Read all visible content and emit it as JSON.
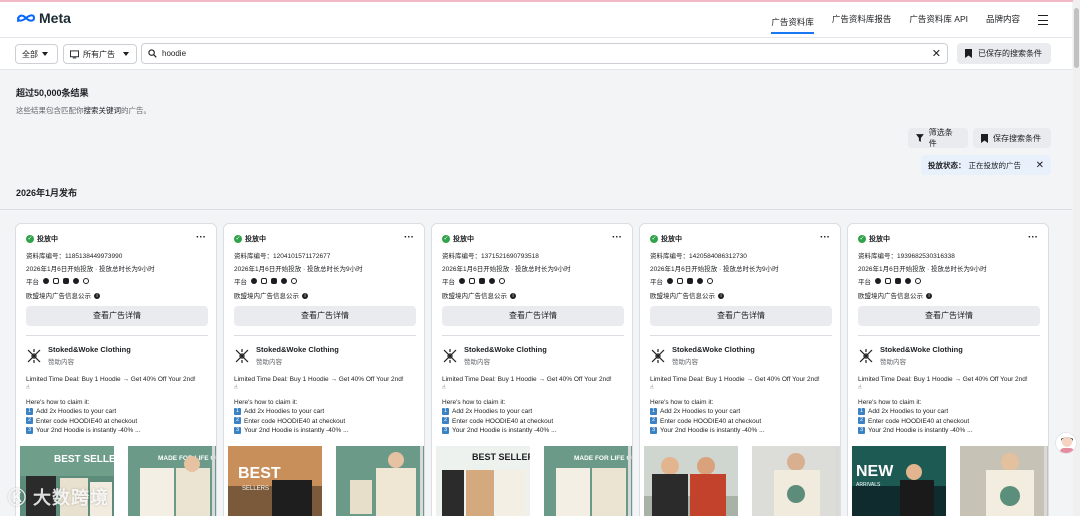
{
  "brand": {
    "name": "Meta"
  },
  "nav": {
    "items": [
      "广告资料库",
      "广告资料库报告",
      "广告资料库 API",
      "品牌内容"
    ],
    "active": "广告资料库"
  },
  "filters": {
    "region": "全部",
    "ad_type": "所有广告",
    "search_value": "hoodie",
    "saved_searches": "已保存的搜索条件"
  },
  "results": {
    "title": "超过50,000条结果",
    "subtitle_pre": "这些结果包含匹配你",
    "subtitle_keyword": "搜索关键词",
    "subtitle_post": "的广告。"
  },
  "actions": {
    "filter": "筛选条件",
    "save_search": "保存搜索条件",
    "status_label": "投放状态：",
    "status_value": "正在投放的广告"
  },
  "section_title": "2026年1月发布",
  "cards": [
    {
      "status": "投放中",
      "library_id": "资料库编号：1185138449973990",
      "date": "2026年1月6日开始投放 · 投放总时长为9小时",
      "platform_label": "平台",
      "eu": "欧盟境内广告信息公示",
      "detail": "查看广告详情",
      "advertiser": "Stoked&Woke Clothing",
      "sponsored": "赞助内容",
      "line1": "Limited Time Deal: Buy 1 Hoodie → Get 40% Off Your 2nd!",
      "line2": "Here's how to claim it:",
      "step1": "Add 2x Hoodies to your cart",
      "step2": "Enter code HOODIE40 at checkout",
      "step3": "Your 2nd Hoodie is instantly -40% ...",
      "media_left": "BEST SELLERS",
      "media_right": "MADE FOR LIFE OU"
    },
    {
      "status": "投放中",
      "library_id": "资料库编号：1204101571172677",
      "date": "2026年1月6日开始投放 · 投放总时长为9小时",
      "platform_label": "平台",
      "eu": "欧盟境内广告信息公示",
      "detail": "查看广告详情",
      "advertiser": "Stoked&Woke Clothing",
      "sponsored": "赞助内容",
      "line1": "Limited Time Deal: Buy 1 Hoodie → Get 40% Off Your 2nd!",
      "line2": "Here's how to claim it:",
      "step1": "Add 2x Hoodies to your cart",
      "step2": "Enter code HOODIE40 at checkout",
      "step3": "Your 2nd Hoodie is instantly -40% ...",
      "media_left": "BEST",
      "media_left_sub": "SELLERS",
      "media_right": ""
    },
    {
      "status": "投放中",
      "library_id": "资料库编号：1371521690793518",
      "date": "2026年1月6日开始投放 · 投放总时长为9小时",
      "platform_label": "平台",
      "eu": "欧盟境内广告信息公示",
      "detail": "查看广告详情",
      "advertiser": "Stoked&Woke Clothing",
      "sponsored": "赞助内容",
      "line1": "Limited Time Deal: Buy 1 Hoodie → Get 40% Off Your 2nd!",
      "line2": "Here's how to claim it:",
      "step1": "Add 2x Hoodies to your cart",
      "step2": "Enter code HOODIE40 at checkout",
      "step3": "Your 2nd Hoodie is instantly -40% ...",
      "media_left": "BEST SELLERS",
      "media_right": "MADE FOR LIFE OU"
    },
    {
      "status": "投放中",
      "library_id": "资料库编号：1420584086312730",
      "date": "2026年1月6日开始投放 · 投放总时长为9小时",
      "platform_label": "平台",
      "eu": "欧盟境内广告信息公示",
      "detail": "查看广告详情",
      "advertiser": "Stoked&Woke Clothing",
      "sponsored": "赞助内容",
      "line1": "Limited Time Deal: Buy 1 Hoodie → Get 40% Off Your 2nd!",
      "line2": "Here's how to claim it:",
      "step1": "Add 2x Hoodies to your cart",
      "step2": "Enter code HOODIE40 at checkout",
      "step3": "Your 2nd Hoodie is instantly -40% ...",
      "media_left": "",
      "media_right": ""
    },
    {
      "status": "投放中",
      "library_id": "资料库编号：1939682530316338",
      "date": "2026年1月6日开始投放 · 投放总时长为9小时",
      "platform_label": "平台",
      "eu": "欧盟境内广告信息公示",
      "detail": "查看广告详情",
      "advertiser": "Stoked&Woke Clothing",
      "sponsored": "赞助内容",
      "line1": "Limited Time Deal: Buy 1 Hoodie → Get 40% Off Your 2nd!",
      "line2": "Here's how to claim it:",
      "step1": "Add 2x Hoodies to your cart",
      "step2": "Enter code HOODIE40 at checkout",
      "step3": "Your 2nd Hoodie is instantly -40% ...",
      "media_left": "NEW",
      "media_left_sub": "ARRIVALS",
      "media_right": ""
    }
  ],
  "watermark": "Ⓚ 大数跨境",
  "colors": {
    "accent": "#1877f2",
    "active_green": "#31a24c",
    "brand_green": "#6b9a88"
  }
}
